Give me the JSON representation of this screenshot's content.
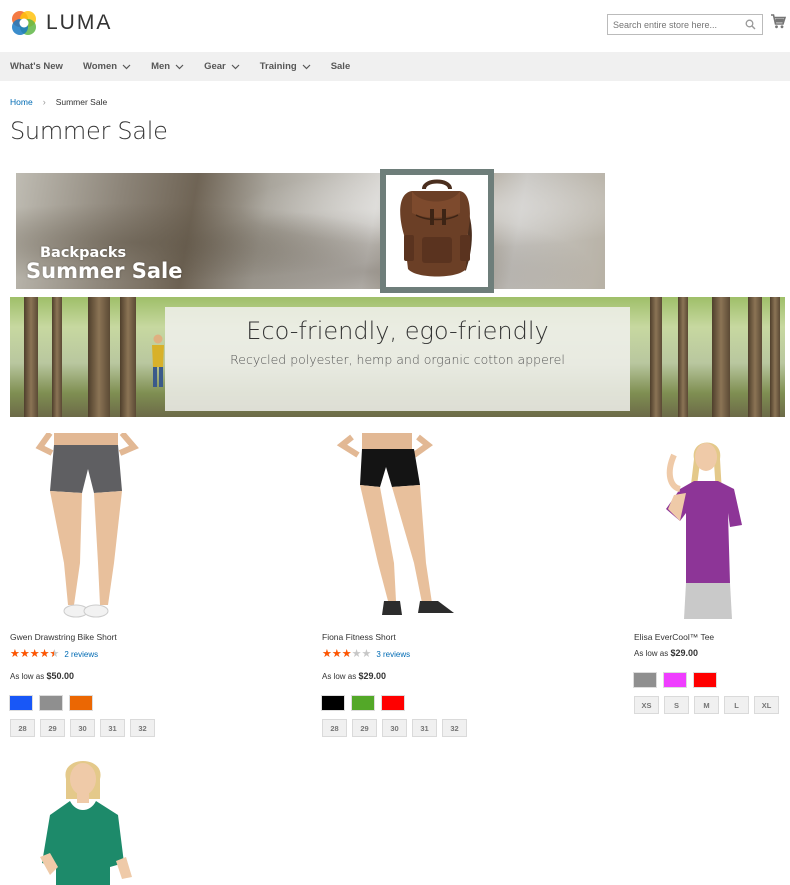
{
  "header": {
    "logo_text": "LUMA",
    "search_placeholder": "Search entire store here..."
  },
  "nav": {
    "items": [
      {
        "label": "What's New",
        "dropdown": false
      },
      {
        "label": "Women",
        "dropdown": true
      },
      {
        "label": "Men",
        "dropdown": true
      },
      {
        "label": "Gear",
        "dropdown": true
      },
      {
        "label": "Training",
        "dropdown": true
      },
      {
        "label": "Sale",
        "dropdown": false
      }
    ]
  },
  "breadcrumbs": {
    "home": "Home",
    "separator": "›",
    "current": "Summer Sale"
  },
  "page_title": "Summer Sale",
  "banner1": {
    "sub": "Backpacks",
    "title": "Summer Sale"
  },
  "banner2": {
    "heading": "Eco-friendly, ego-friendly",
    "text": "Recycled polyester, hemp and organic cotton apperel"
  },
  "products": [
    {
      "name": "Gwen Drawstring Bike Short",
      "rating_pct": 90,
      "reviews": "2 reviews",
      "price_prefix": "As low as",
      "price": "$50.00",
      "swatches": [
        "#1857f7",
        "#8f8f8f",
        "#eb6703"
      ],
      "sizes": [
        "28",
        "29",
        "30",
        "31",
        "32"
      ]
    },
    {
      "name": "Fiona Fitness Short",
      "rating_pct": 60,
      "reviews": "3 reviews",
      "price_prefix": "As low as",
      "price": "$29.00",
      "swatches": [
        "#000000",
        "#53a828",
        "#ff0000"
      ],
      "sizes": [
        "28",
        "29",
        "30",
        "31",
        "32"
      ]
    },
    {
      "name": "Elisa EverCool™ Tee",
      "price_prefix": "As low as",
      "price": "$29.00",
      "swatches": [
        "#8f8f8f",
        "#ef3dff",
        "#ff0000"
      ],
      "sizes": [
        "XS",
        "S",
        "M",
        "L",
        "XL"
      ]
    }
  ],
  "colors": {
    "link": "#006bb4",
    "star": "#ff5501",
    "nav_bg": "#f0f0f0"
  }
}
